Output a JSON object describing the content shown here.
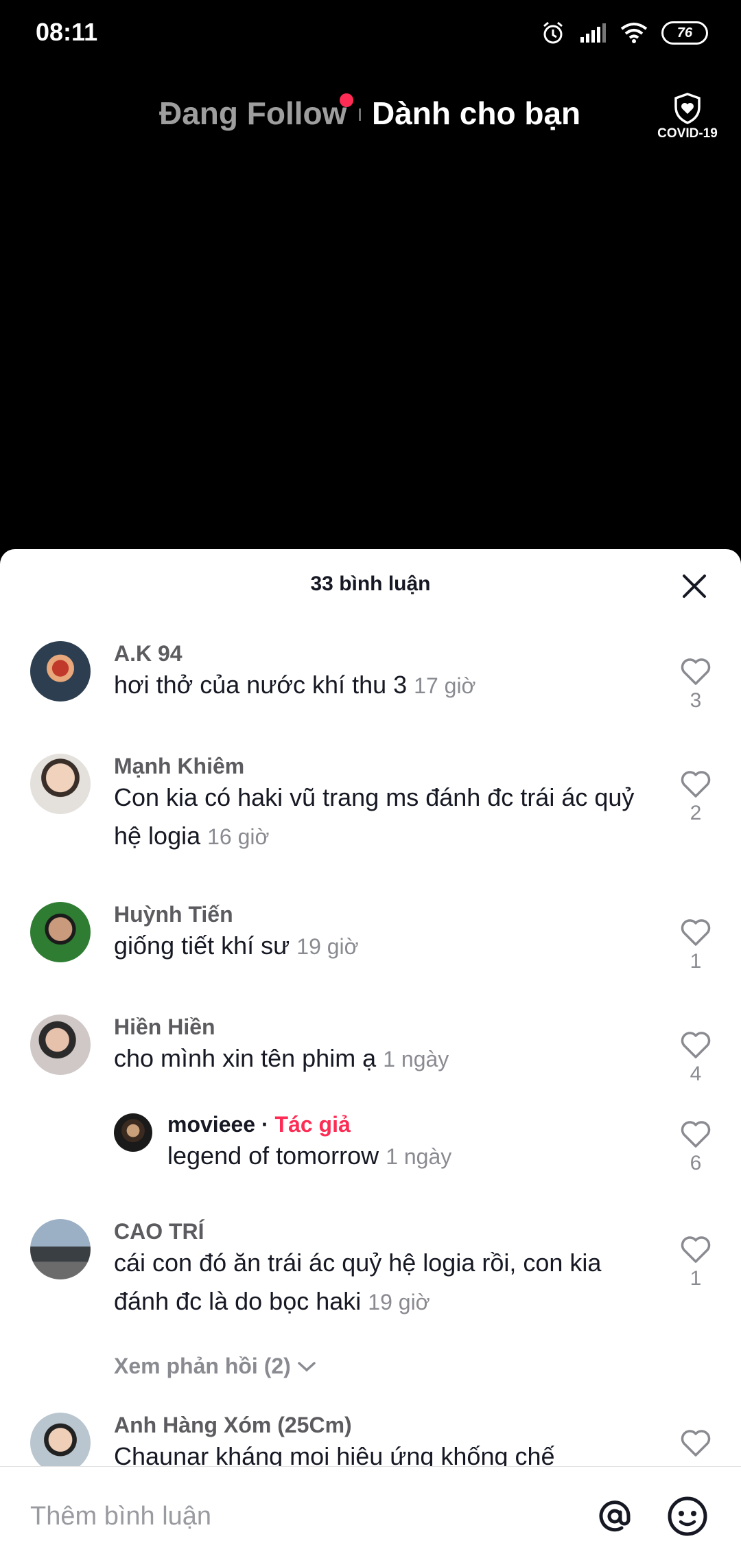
{
  "status_bar": {
    "time": "08:11",
    "battery": "76",
    "icons": [
      "alarm-icon",
      "signal-icon",
      "wifi-icon",
      "battery-icon"
    ]
  },
  "top_nav": {
    "tab_following": "Đang Follow",
    "tab_for_you": "Dành cho bạn",
    "covid_label": "COVID-19"
  },
  "comments_panel": {
    "count_label": "33 bình luận",
    "comments": [
      {
        "name": "A.K 94",
        "text": "hơi thở của nước khí thu 3",
        "time": "17 giờ",
        "likes": "3"
      },
      {
        "name": "Mạnh Khiêm",
        "text": "Con kia có haki vũ trang ms đánh đc trái ác quỷ hệ logia",
        "time": "16 giờ",
        "likes": "2"
      },
      {
        "name": "Huỳnh Tiến",
        "text": "giống tiết khí sư",
        "time": "19 giờ",
        "likes": "1"
      },
      {
        "name": "Hiền Hiền",
        "text": "cho mình xin tên phim ạ",
        "time": "1 ngày",
        "likes": "4"
      },
      {
        "name": "CAO TRÍ",
        "text": "cái con đó ăn trái ác quỷ hệ logia rồi, con kia đánh đc là do bọc haki",
        "time": "19 giờ",
        "likes": "1"
      },
      {
        "name": "Anh Hàng Xóm (25Cm)",
        "text": "Chaunar kháng mọi hiệu ứng khống chế",
        "likes": ""
      }
    ],
    "reply": {
      "name": "movieee",
      "separator": " · ",
      "tag": "Tác giả",
      "text": "legend of tomorrow",
      "time": "1 ngày",
      "likes": "6"
    },
    "view_replies": "Xem phản hồi (2)"
  },
  "input_bar": {
    "placeholder": "Thêm bình luận",
    "mention_icon": "at-icon",
    "emoji_icon": "emoji-icon"
  },
  "colors": {
    "accent": "#fe2c55",
    "text_primary": "#161823",
    "text_secondary": "#8a8b91"
  }
}
